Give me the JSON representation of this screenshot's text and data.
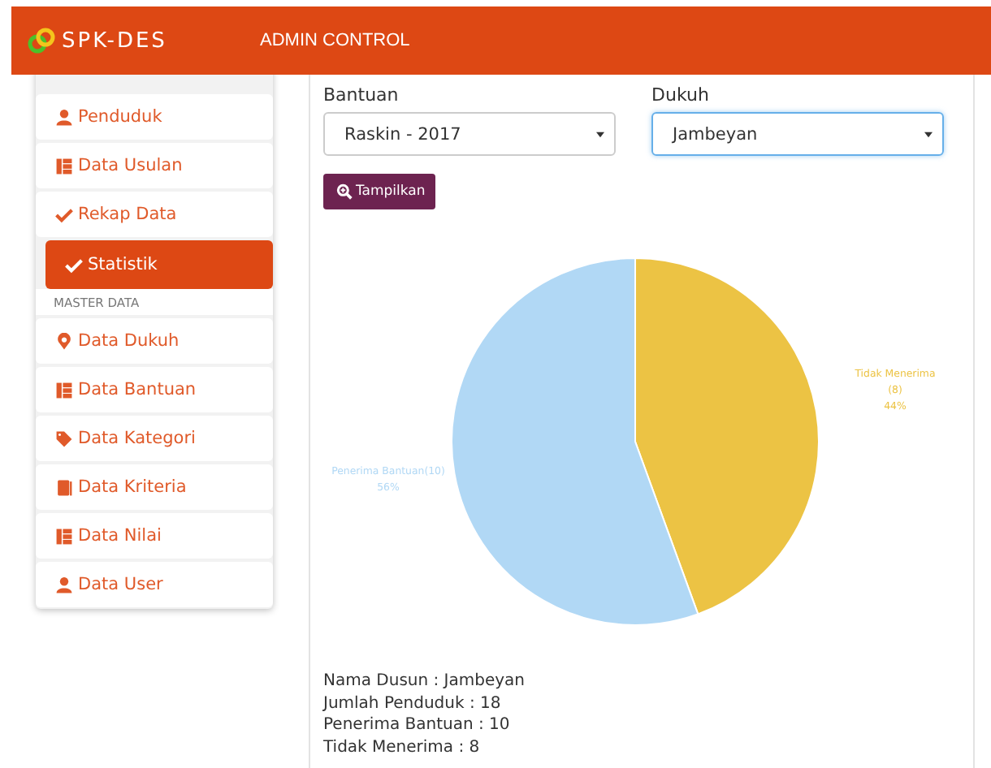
{
  "header": {
    "brand": "SPK-DES",
    "title": "ADMIN CONTROL"
  },
  "sidebar": {
    "items": [
      {
        "kind": "link",
        "label": "Penduduk",
        "selected": false
      },
      {
        "kind": "link",
        "label": "Data Usulan",
        "selected": false
      },
      {
        "kind": "link",
        "label": "Rekap Data",
        "selected": false
      },
      {
        "kind": "link",
        "label": "Statistik",
        "selected": true
      },
      {
        "kind": "heading",
        "label": "MASTER DATA"
      },
      {
        "kind": "link",
        "label": "Data Dukuh",
        "selected": false
      },
      {
        "kind": "link",
        "label": "Data Bantuan",
        "selected": false
      },
      {
        "kind": "link",
        "label": "Data Kategori",
        "selected": false
      },
      {
        "kind": "link",
        "label": "Data Kriteria",
        "selected": false
      },
      {
        "kind": "link",
        "label": "Data Nilai",
        "selected": false
      },
      {
        "kind": "link",
        "label": "Data User",
        "selected": false
      }
    ]
  },
  "filters": [
    {
      "label": "Bantuan",
      "value": "Raskin - 2017",
      "focused": false
    },
    {
      "label": "Dukuh",
      "value": "Jambeyan",
      "focused": true
    }
  ],
  "button": "Tampilkan",
  "chart": {
    "chart_data": {
      "type": "pie",
      "categories": [
        "Tidak Menerima",
        "Penerima Bantuan"
      ],
      "values": [
        8,
        10
      ],
      "colors": [
        "#ecc344",
        "#b1d8f5"
      ],
      "data_labels": "value_labels",
      "value_labels": [
        "(8)",
        "(10)"
      ],
      "annotations": [
        "44%",
        "56%"
      ]
    }
  },
  "summary": [
    "Nama Dusun : Jambeyan",
    "Jumlah Penduduk : 18",
    "Penerima Bantuan : 10",
    "Tidak Menerima : 8"
  ]
}
